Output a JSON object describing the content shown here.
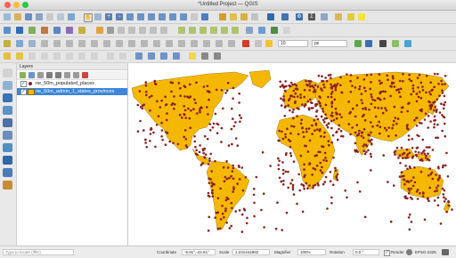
{
  "window": {
    "title": "*Untitled Project — QGIS"
  },
  "layers_panel": {
    "title": "Layers",
    "layers": [
      {
        "name": "ne_50m_populated_places",
        "checked": true,
        "selected": false
      },
      {
        "name": "ne_50m_admin_1_states_provinces",
        "checked": true,
        "selected": true
      }
    ]
  },
  "style_toolbar": {
    "font_size": "10",
    "unit": "px"
  },
  "statusbar": {
    "locate_placeholder": "Type to locate (⌘K)",
    "coordinate_label": "Coordinate",
    "coordinate_value": "-5.91°,-44.81°",
    "scale_label": "Scale",
    "scale_value": "1:231442882",
    "magnifier_label": "Magnifier",
    "magnifier_value": "100%",
    "rotation_label": "Rotation",
    "rotation_value": "0.0 °",
    "render_label": "Render",
    "crs": "EPSG:4326"
  },
  "colors": {
    "land": "#f5b800",
    "outline": "#7a6a2a",
    "points": "#8b1f1f",
    "selection": "#3d86d8"
  }
}
